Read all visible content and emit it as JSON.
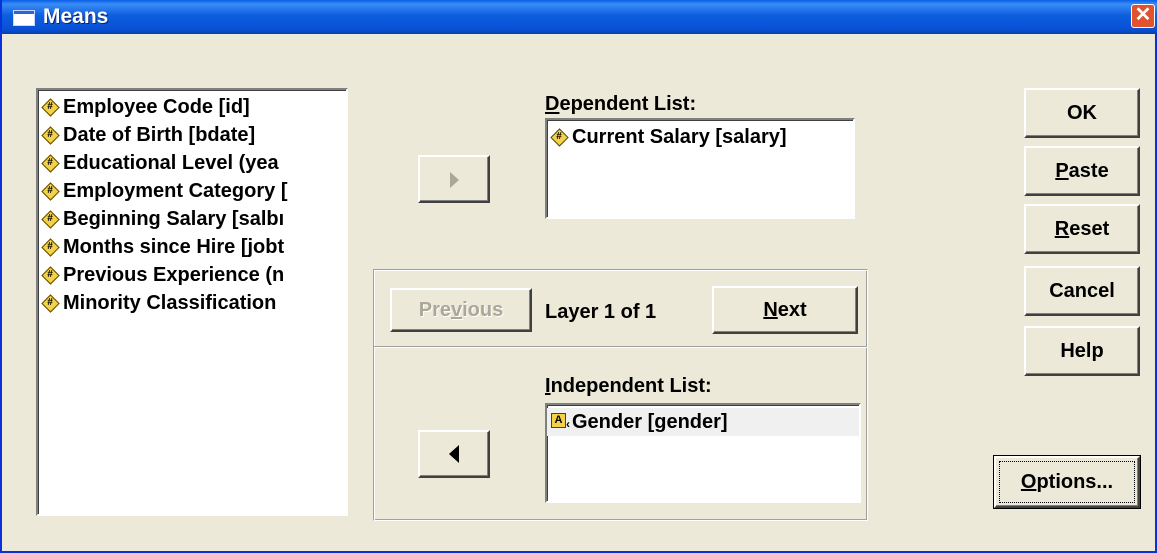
{
  "window": {
    "title": "Means",
    "close_glyph": "✕"
  },
  "variables": [
    {
      "label": "Employee Code [id]",
      "icon": "numeric-variable-icon"
    },
    {
      "label": "Date of Birth [bdate]",
      "icon": "numeric-variable-icon"
    },
    {
      "label": "Educational Level (yea",
      "icon": "numeric-variable-icon"
    },
    {
      "label": "Employment Category [",
      "icon": "numeric-variable-icon"
    },
    {
      "label": "Beginning Salary [salbı",
      "icon": "numeric-variable-icon"
    },
    {
      "label": "Months since Hire [jobt",
      "icon": "numeric-variable-icon"
    },
    {
      "label": "Previous Experience (n",
      "icon": "numeric-variable-icon"
    },
    {
      "label": "Minority Classification",
      "icon": "numeric-variable-icon"
    }
  ],
  "dependent": {
    "caption": "Dependent List:",
    "caption_underline": "D",
    "items": [
      {
        "label": "Current Salary [salary]",
        "icon": "numeric-variable-icon"
      }
    ]
  },
  "layer": {
    "previous_label": "Previous",
    "previous_underline": "v",
    "text": "Layer 1 of 1",
    "next_label": "Next",
    "next_underline": "N"
  },
  "independent": {
    "caption": "Independent List:",
    "caption_underline": "I",
    "items": [
      {
        "label": "Gender [gender]",
        "icon": "string-variable-icon",
        "icon_glyph": "A"
      }
    ]
  },
  "buttons": {
    "ok": "OK",
    "paste": "Paste",
    "reset": "Reset",
    "cancel": "Cancel",
    "help": "Help",
    "options": "Options..."
  },
  "icons": {
    "numeric_glyph": "#"
  }
}
